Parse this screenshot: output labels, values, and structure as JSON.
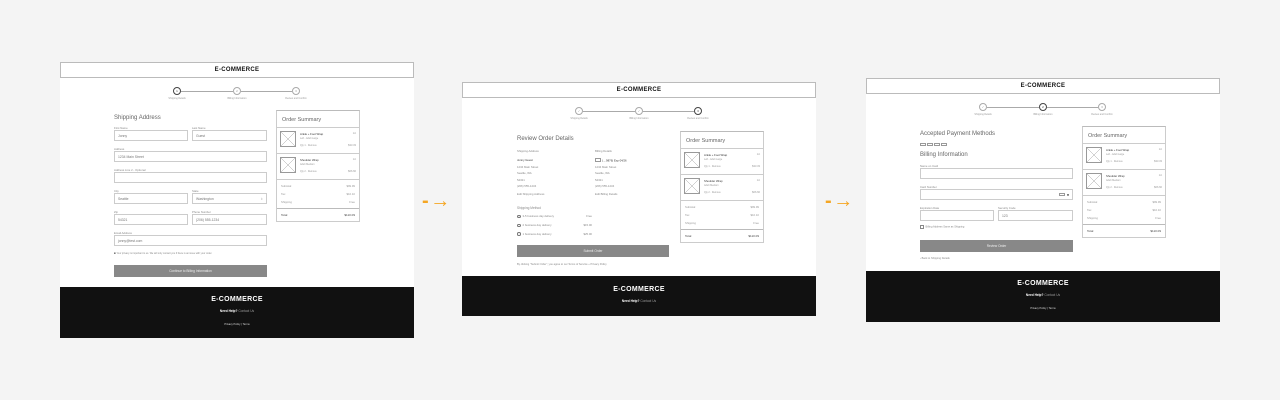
{
  "brand": "E-COMMERCE",
  "steps": [
    "Shipping Details",
    "Billing Information",
    "Review and Confirm"
  ],
  "step_numbers": [
    "1",
    "2",
    "3"
  ],
  "check": "✓",
  "summary": {
    "title": "Order Summary",
    "items": [
      {
        "name": "Ankle + Foot Wrap",
        "variant": "Left - Adult Large",
        "qty": "Qty 1",
        "remove": "Remove",
        "unit": "1ct",
        "price": "$33.33"
      },
      {
        "name": "Shoulder Wrap",
        "variant": "Adult Medium",
        "qty": "Qty 2",
        "remove": "Remove",
        "unit": "1ct",
        "price": "$66.66"
      }
    ],
    "subtotal_label": "Subtotal",
    "subtotal": "$99.99",
    "tax_label": "Tax",
    "tax": "$10.10",
    "shipping_label": "Shipping",
    "shipping": "Free",
    "total_label": "Total",
    "total": "$110.09"
  },
  "footer": {
    "need_help": "Need Help?",
    "contact": "Contact Us",
    "privacy": "Privacy Policy",
    "sep": "|",
    "terms": "Terms"
  },
  "shipping": {
    "title": "Shipping Address",
    "first_name_label": "First Name",
    "first_name": "Jonny",
    "last_name_label": "Last Name",
    "last_name": "Guest",
    "address_label": "Address",
    "address": "1234 Main Street",
    "address2_label": "Address Line 2 - Optional",
    "address2": "",
    "city_label": "City",
    "city": "Seattle",
    "state_label": "State",
    "state": "Washington",
    "zip_label": "Zip",
    "zip": "54321",
    "phone_label": "Phone Number",
    "phone": "(206) 555-1234",
    "email_label": "Email Address",
    "email": "jonny@test.com",
    "privacy_note": "Your privacy is important to us. We will only contact you if there is an issue with your order.",
    "continue_button": "Continue to Billing Information"
  },
  "review": {
    "title": "Review Order Details",
    "ship_heading": "Shipping Address",
    "ship_lines": [
      "Jonny Guest",
      "1234 Main Street",
      "Seattle, WA",
      "54321",
      "(206) 555-1234"
    ],
    "edit_shipping": "Edit Shipping Address",
    "bill_heading": "Billing Details",
    "card_line": "(....9876) Exp 04/26",
    "bill_lines": [
      "1234 Main Street",
      "Seattle, WA",
      "54321",
      "(206) 555-1234"
    ],
    "edit_billing": "Edit Billing Details",
    "method_heading": "Shipping Method",
    "methods": [
      {
        "label": "3-5 business day delivery",
        "price": "Free"
      },
      {
        "label": "2 business day delivery",
        "price": "$15.00"
      },
      {
        "label": "1 business day delivery",
        "price": "$25.00"
      }
    ],
    "submit_button": "Submit Order",
    "terms_note": "By clicking \"Submit Order\", you agree to our Terms of Service + Privacy Policy"
  },
  "billing": {
    "payment_title": "Accepted Payment Methods",
    "title": "Billing Information",
    "name_label": "Name on Card",
    "name": "",
    "card_label": "Card Number",
    "card": "",
    "exp_label": "Expiration Date",
    "exp": "",
    "cvc_label": "Security Code",
    "cvc": "123",
    "same_label": "Billing Address Same as Shipping",
    "review_button": "Review Order",
    "back_link": "Back to Shipping Details"
  },
  "arrow": "→",
  "accent": "#f5a623"
}
